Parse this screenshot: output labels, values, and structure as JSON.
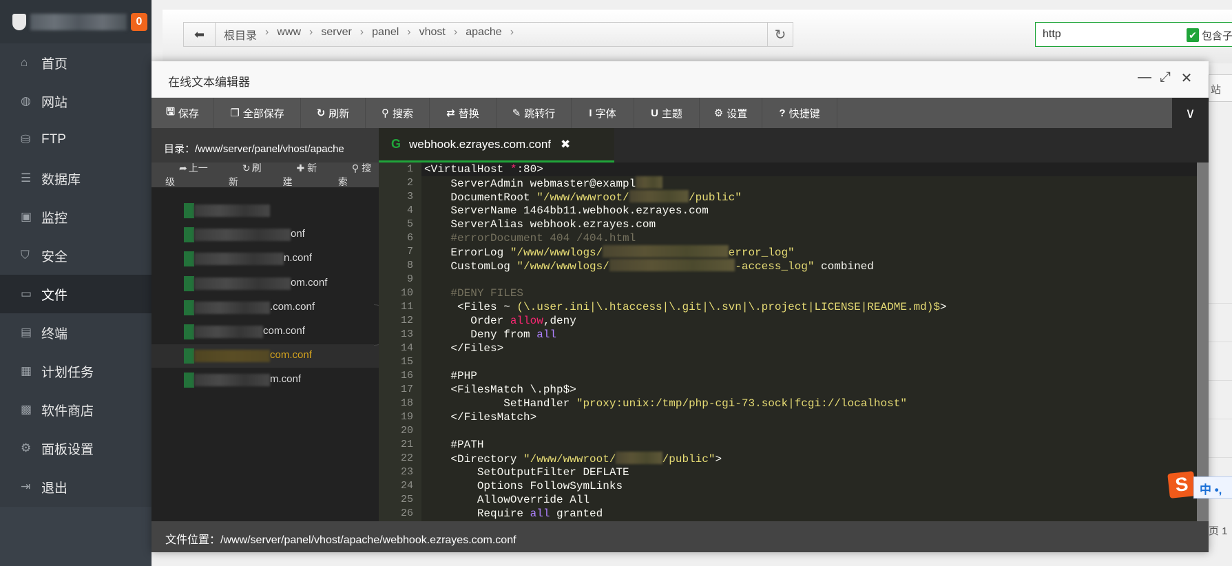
{
  "sidebar": {
    "badge": "0",
    "items": [
      {
        "label": "首页",
        "icon": "home-icon",
        "glyph": "⌂"
      },
      {
        "label": "网站",
        "icon": "globe-icon",
        "glyph": "◍"
      },
      {
        "label": "FTP",
        "icon": "ftp-icon",
        "glyph": "⛁"
      },
      {
        "label": "数据库",
        "icon": "database-icon",
        "glyph": "☰"
      },
      {
        "label": "监控",
        "icon": "monitor-icon",
        "glyph": "▣"
      },
      {
        "label": "安全",
        "icon": "shield-icon",
        "glyph": "⛉"
      },
      {
        "label": "文件",
        "icon": "folder-icon",
        "glyph": "▭",
        "active": true
      },
      {
        "label": "终端",
        "icon": "terminal-icon",
        "glyph": "▤"
      },
      {
        "label": "计划任务",
        "icon": "calendar-icon",
        "glyph": "▦"
      },
      {
        "label": "软件商店",
        "icon": "apps-icon",
        "glyph": "▩"
      },
      {
        "label": "面板设置",
        "icon": "gear-icon",
        "glyph": "⚙"
      },
      {
        "label": "退出",
        "icon": "logout-icon",
        "glyph": "⇥"
      }
    ]
  },
  "breadcrumb": [
    "根目录",
    "www",
    "server",
    "panel",
    "vhost",
    "apache"
  ],
  "search": {
    "value": "http",
    "checkbox_label": "包含子",
    "checked": true
  },
  "background": {
    "site_button": "站",
    "pager_text": "页 1"
  },
  "editor": {
    "title": "在线文本编辑器",
    "toolbar": [
      {
        "label": "保存",
        "icon": "save-icon",
        "glyph": "🖫"
      },
      {
        "label": "全部保存",
        "icon": "save-all-icon",
        "glyph": "❐"
      },
      {
        "label": "刷新",
        "icon": "refresh-icon",
        "glyph": "↻"
      },
      {
        "label": "搜索",
        "icon": "search-icon",
        "glyph": "⚲"
      },
      {
        "label": "替换",
        "icon": "replace-icon",
        "glyph": "⇄"
      },
      {
        "label": "跳转行",
        "icon": "pin-icon",
        "glyph": "✎"
      },
      {
        "label": "字体",
        "icon": "font-icon",
        "glyph": "I"
      },
      {
        "label": "主题",
        "icon": "magnet-icon",
        "glyph": "U"
      },
      {
        "label": "设置",
        "icon": "gear-icon",
        "glyph": "⚙"
      },
      {
        "label": "快捷键",
        "icon": "help-icon",
        "glyph": "?"
      }
    ],
    "dir_label": "目录：/www/server/panel/vhost/apache",
    "dir_actions": [
      "上一级",
      "刷新",
      "新建",
      "搜索"
    ],
    "files": [
      {
        "visible": ""
      },
      {
        "visible": "onf"
      },
      {
        "visible": "n.conf"
      },
      {
        "visible": "om.conf"
      },
      {
        "visible": ".com.conf"
      },
      {
        "visible": "com.conf"
      },
      {
        "visible": "com.conf",
        "selected": true
      },
      {
        "visible": "m.conf"
      }
    ],
    "tab": {
      "filename": "webhook.ezrayes.com.conf",
      "close": "✖"
    },
    "code": [
      [
        [
          "<VirtualHost ",
          "p"
        ],
        [
          "*",
          "k"
        ],
        [
          ":80>",
          "p"
        ]
      ],
      [
        [
          "    ServerAdmin webmaster@exampl",
          "p"
        ],
        [
          "",
          "r4"
        ]
      ],
      [
        [
          "    DocumentRoot ",
          "p"
        ],
        [
          "\"/www/wwwroot/",
          "s"
        ],
        [
          "",
          "r9"
        ],
        [
          "/public\"",
          "s"
        ]
      ],
      [
        [
          "    ServerName 1464bb11.webhook.ezrayes.com",
          "p"
        ]
      ],
      [
        [
          "    ServerAlias webhook.ezrayes.com",
          "p"
        ]
      ],
      [
        [
          "    #errorDocument 404 /404.html",
          "c"
        ]
      ],
      [
        [
          "    ErrorLog ",
          "p"
        ],
        [
          "\"/www/wwwlogs/",
          "s"
        ],
        [
          "",
          "r19"
        ],
        [
          "error_log\"",
          "s"
        ]
      ],
      [
        [
          "    CustomLog ",
          "p"
        ],
        [
          "\"/www/wwwlogs/",
          "s"
        ],
        [
          "",
          "r19"
        ],
        [
          "-access_log\"",
          "s"
        ],
        [
          " combined",
          "p"
        ]
      ],
      [
        [
          "",
          "p"
        ]
      ],
      [
        [
          "    #DENY FILES",
          "c"
        ]
      ],
      [
        [
          "     <Files ~ ",
          "p"
        ],
        [
          "(\\.user.ini|\\.htaccess|\\.git|\\.svn|\\.project|LICENSE|README.md)$",
          "s"
        ],
        [
          ">",
          "p"
        ]
      ],
      [
        [
          "       Order ",
          "p"
        ],
        [
          "allow",
          "k"
        ],
        [
          ",deny",
          "p"
        ]
      ],
      [
        [
          "       Deny from ",
          "p"
        ],
        [
          "all",
          "n"
        ]
      ],
      [
        [
          "    </Files>",
          "p"
        ]
      ],
      [
        [
          "",
          "p"
        ]
      ],
      [
        [
          "    #PHP",
          "p"
        ]
      ],
      [
        [
          "    <FilesMatch \\.php$>",
          "p"
        ]
      ],
      [
        [
          "            SetHandler ",
          "p"
        ],
        [
          "\"proxy:unix:/tmp/php-cgi-73.sock|fcgi://localhost\"",
          "s"
        ]
      ],
      [
        [
          "    </FilesMatch>",
          "p"
        ]
      ],
      [
        [
          "",
          "p"
        ]
      ],
      [
        [
          "    #PATH",
          "p"
        ]
      ],
      [
        [
          "    <Directory ",
          "p"
        ],
        [
          "\"/www/wwwroot/",
          "s"
        ],
        [
          "",
          "r7"
        ],
        [
          "/public\"",
          "s"
        ],
        [
          ">",
          "p"
        ]
      ],
      [
        [
          "        SetOutputFilter DEFLATE",
          "p"
        ]
      ],
      [
        [
          "        Options FollowSymLinks",
          "p"
        ]
      ],
      [
        [
          "        AllowOverride All",
          "p"
        ]
      ],
      [
        [
          "        Require ",
          "p"
        ],
        [
          "all",
          "n"
        ],
        [
          " granted",
          "p"
        ]
      ]
    ],
    "footer": "文件位置：/www/server/panel/vhost/apache/webhook.ezrayes.com.conf"
  },
  "ime": {
    "logo": "S",
    "mode": "中 •,"
  },
  "colors": {
    "accent": "#20a53a",
    "badge": "#f0651c",
    "selected_file": "#d5a41e",
    "string": "#e6db74",
    "comment": "#75715e",
    "keyword": "#f92672",
    "constant": "#ae81ff"
  }
}
